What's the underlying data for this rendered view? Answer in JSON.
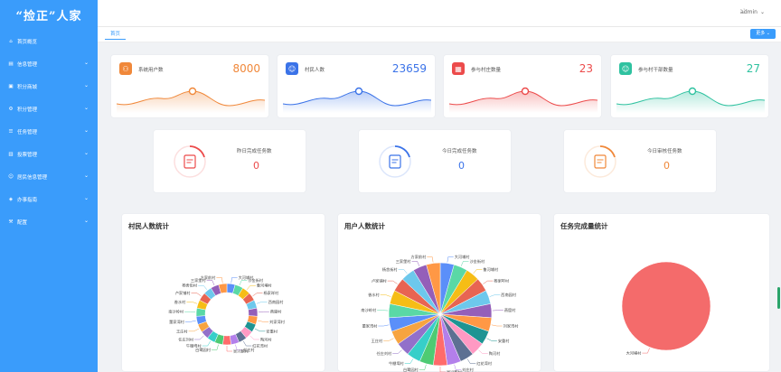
{
  "app": {
    "logo": "“捡正”人家"
  },
  "sidebar": {
    "items": [
      {
        "label": "首页概览",
        "icon": "home-icon",
        "chevron": false
      },
      {
        "label": "信息管理",
        "icon": "document-icon",
        "chevron": true
      },
      {
        "label": "积分商城",
        "icon": "shop-icon",
        "chevron": true
      },
      {
        "label": "积分管理",
        "icon": "gear-icon",
        "chevron": true
      },
      {
        "label": "任务管理",
        "icon": "list-icon",
        "chevron": true
      },
      {
        "label": "投票管理",
        "icon": "vote-icon",
        "chevron": true
      },
      {
        "label": "居民信息管理",
        "icon": "users-icon",
        "chevron": true
      },
      {
        "label": "办事指南",
        "icon": "guide-icon",
        "chevron": true
      },
      {
        "label": "配置",
        "icon": "config-icon",
        "chevron": true
      }
    ]
  },
  "header": {
    "user": "admin"
  },
  "tabs": {
    "home": "首页",
    "more": "更多"
  },
  "stats": [
    {
      "label": "系统用户数",
      "value": "8000",
      "color": "#f0883a"
    },
    {
      "label": "村民人数",
      "value": "23659",
      "color": "#3b73e8"
    },
    {
      "label": "参与村庄数量",
      "value": "23",
      "color": "#ec4b4b"
    },
    {
      "label": "参与村干部数量",
      "value": "27",
      "color": "#2fc2a0"
    }
  ],
  "tasks": [
    {
      "label": "昨日完成任务数",
      "value": "0",
      "color": "#ec4b4b"
    },
    {
      "label": "今日完成任务数",
      "value": "0",
      "color": "#3b73e8"
    },
    {
      "label": "今日审核任务数",
      "value": "0",
      "color": "#f0883a"
    }
  ],
  "panels": [
    {
      "title": "村民人数统计"
    },
    {
      "title": "用户人数统计"
    },
    {
      "title": "任务完成量统计"
    }
  ],
  "chart_data": [
    {
      "type": "pie",
      "variant": "donut",
      "title": "村民人数统计",
      "categories": [
        "大河埔村",
        "沙金街村",
        "鲁河埔村",
        "杨家咩村",
        "西南园村",
        "燕窟村",
        "刘家湾村",
        "安重村",
        "陶河村",
        "红花湾村",
        "刘庄村",
        "吴兴鹅村",
        "白鹭园村",
        "牛棚塆村",
        "任庄刘村",
        "王庄村",
        "董家湾村",
        "南沙岭村",
        "香水村",
        "卢家铺村",
        "杨舍街村",
        "三家堡村",
        "方家前村"
      ],
      "values": [
        1,
        1,
        1,
        1,
        1,
        1,
        1,
        1,
        1,
        1,
        1,
        1,
        1,
        1,
        1,
        1,
        1,
        1,
        1,
        1,
        1,
        1,
        1
      ]
    },
    {
      "type": "pie",
      "title": "用户人数统计",
      "categories": [
        "大河埔村",
        "沙金街村",
        "鲁河埔村",
        "杨家咩村",
        "西南园村",
        "燕窟村",
        "刘家湾村",
        "安重村",
        "陶河村",
        "红花湾村",
        "刘庄村",
        "吴兴鹅村",
        "白鹭园村",
        "牛棚塆村",
        "任庄刘村",
        "王庄村",
        "董家湾村",
        "南沙岭村",
        "香水村",
        "卢家铺村",
        "杨舍街村",
        "三家堡村",
        "方家前村"
      ],
      "values": [
        1,
        1,
        1,
        1,
        1,
        1,
        1,
        1,
        1,
        1,
        1,
        1,
        1,
        1,
        1,
        1,
        1,
        1,
        1,
        1,
        1,
        1,
        1
      ]
    },
    {
      "type": "pie",
      "title": "任务完成量统计",
      "categories": [
        "大河埔村"
      ],
      "values": [
        1
      ]
    }
  ],
  "palette": [
    "#5b8ff9",
    "#5ad8a6",
    "#f6bd16",
    "#e86452",
    "#6dc8ec",
    "#945fb9",
    "#ff9845",
    "#1e9493",
    "#ff99c3",
    "#5d7092",
    "#b37feb",
    "#ff6b6b",
    "#4ecb73",
    "#36cfc9",
    "#9270ca",
    "#f7a440"
  ],
  "pie_single_color": "#f46b6b"
}
